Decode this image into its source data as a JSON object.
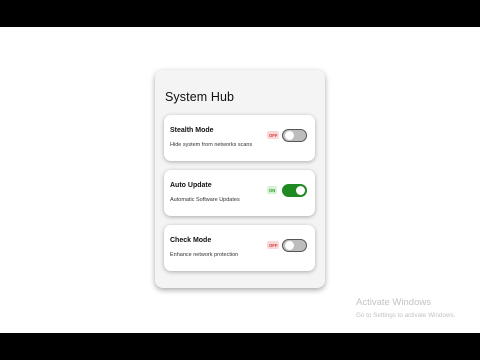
{
  "hub": {
    "title": "System Hub"
  },
  "items": [
    {
      "title": "Stealth Mode",
      "description": "Hide system from networks scans",
      "badge": "OFF",
      "enabled": false
    },
    {
      "title": "Auto Update",
      "description": "Automatic Software Updates",
      "badge": "ON",
      "enabled": true
    },
    {
      "title": "Check Mode",
      "description": "Enhance network protection",
      "badge": "OFF",
      "enabled": false
    }
  ],
  "watermark": {
    "title": "Activate Windows",
    "subtitle": "Go to Settings to activate Windows."
  },
  "colors": {
    "on": "#1f8a22",
    "off": "#bdbdbd",
    "badge_off": "#d23a3a",
    "badge_on": "#2e9a2e"
  }
}
